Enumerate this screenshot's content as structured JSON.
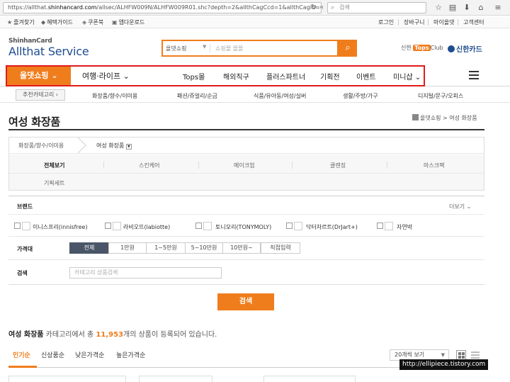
{
  "browser": {
    "url_prefix": "https://allthat.",
    "url_host": "shinhancard.com",
    "url_rest": "/allsec/ALHFW009N/ALHFW009R01.shc?depth=2&allthCagCcd=1&allthCagId=0601",
    "reload_glyph": "↻",
    "back_glyph": "‹",
    "search_placeholder": "검색",
    "icons": [
      "star-icon",
      "bookmarks-icon",
      "download-icon",
      "home-icon",
      "menu-icon"
    ]
  },
  "bookmarks": [
    {
      "label": "즐겨찾기",
      "icon": "star-icon"
    },
    {
      "label": "혜택가이드",
      "icon": "bookmark-icon"
    },
    {
      "label": "쿠폰북",
      "icon": "tag-icon"
    },
    {
      "label": "앱다운로드",
      "icon": "app-icon"
    }
  ],
  "top_links": [
    "로그인",
    "장바구니",
    "마이올댓",
    "고객센터"
  ],
  "header": {
    "logo_top": "ShinhanCard",
    "logo_main": "Allthat Service",
    "search_category": "올댓쇼핑",
    "search_placeholder": "쇼핑몰 몰몰",
    "tops_prefix": "신한",
    "tops_badge": "Tops",
    "tops_suffix": "Club",
    "card_brand": "신한카드"
  },
  "main_nav": {
    "shop": "올댓쇼핑",
    "travel": "여행·라이프",
    "items": [
      "Tops몰",
      "해외직구",
      "플러스파트너",
      "기획전",
      "이벤트",
      "미니샵"
    ]
  },
  "category_nav": {
    "recommended": "추천카테고리",
    "items": [
      "화장품/향수/이미용",
      "패션/쥬얼리/순금",
      "식품/유아동/여성/실버",
      "생활/주방/가구",
      "디지털/문구/오피스"
    ]
  },
  "page": {
    "title": "여성 화장품",
    "breadcrumb_root": "올댓쇼핑",
    "breadcrumb_sep": ">",
    "breadcrumb_current": "여성 화장품"
  },
  "subcategory": {
    "parent": "화장품/향수/이미용",
    "current": "여성 화장품",
    "row1": [
      "전체보기",
      "스킨케어",
      "메이크업",
      "클렌징",
      "마스크팩"
    ],
    "row2": [
      "기획세트"
    ]
  },
  "filters": {
    "brand_label": "브랜드",
    "more_label": "더보기",
    "brands": [
      "이니스프리(innisfree)",
      "라비오뜨(labiotte)",
      "토니모리(TONYMOLY)",
      "닥터자르트(DrJart+)",
      "자연박"
    ],
    "price_label": "가격대",
    "price_options": [
      "전체",
      "1만원",
      "1~5만원",
      "5~10만원",
      "10만원~",
      "직접입력"
    ],
    "price_selected": 0,
    "search_label": "검색",
    "search_placeholder": "카테고리 상품검색",
    "search_button": "검색"
  },
  "results": {
    "category": "여성 화장품",
    "text_before": " 카테고리에서 총 ",
    "count": "11,953",
    "text_after": "개의 상품이 등록되어 있습니다."
  },
  "sort_tabs": [
    "인기순",
    "신상품순",
    "낮은가격순",
    "높은가격순"
  ],
  "per_page": "20개씩 보기",
  "watermark": "http://ellipiece.tistory.com"
}
